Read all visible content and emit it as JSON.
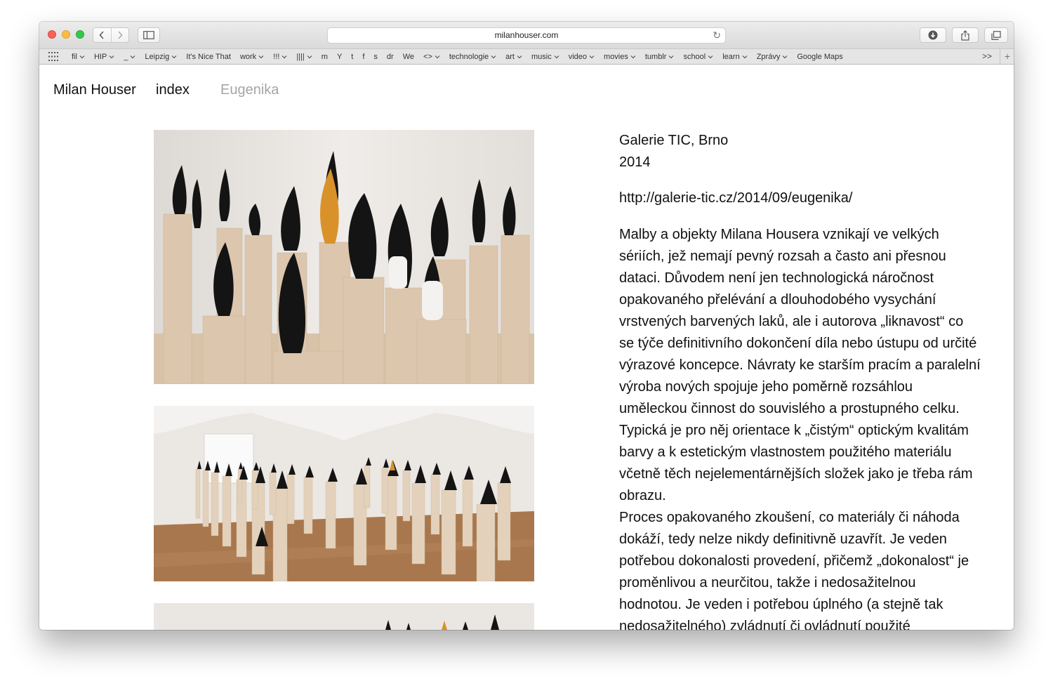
{
  "browser": {
    "url": "milanhouser.com",
    "bookmarks": [
      {
        "label": "fil",
        "menu": true
      },
      {
        "label": "HIP",
        "menu": true
      },
      {
        "label": "_",
        "menu": true
      },
      {
        "label": "Leipzig",
        "menu": true
      },
      {
        "label": "It's Nice That",
        "menu": false
      },
      {
        "label": "work",
        "menu": true
      },
      {
        "label": "!!!",
        "menu": true
      },
      {
        "label": "||||",
        "menu": true
      },
      {
        "label": "m",
        "menu": false
      },
      {
        "label": "Y",
        "menu": false
      },
      {
        "label": "t",
        "menu": false
      },
      {
        "label": "f",
        "menu": false
      },
      {
        "label": "s",
        "menu": false
      },
      {
        "label": "dr",
        "menu": false
      },
      {
        "label": "We",
        "menu": false
      },
      {
        "label": "<>",
        "menu": true
      },
      {
        "label": "technologie",
        "menu": true
      },
      {
        "label": "art",
        "menu": true
      },
      {
        "label": "music",
        "menu": true
      },
      {
        "label": "video",
        "menu": true
      },
      {
        "label": "movies",
        "menu": true
      },
      {
        "label": "tumblr",
        "menu": true
      },
      {
        "label": "school",
        "menu": true
      },
      {
        "label": "learn",
        "menu": true
      },
      {
        "label": "Zprávy",
        "menu": true
      },
      {
        "label": "Google Maps",
        "menu": false
      }
    ],
    "more_label": ">>",
    "plus_label": "+"
  },
  "site": {
    "name": "Milan Houser",
    "index": "index",
    "current": "Eugenika"
  },
  "exhibition": {
    "gallery": "Galerie TIC, Brno",
    "year": "2014",
    "link": "http://galerie-tic.cz/2014/09/eugenika/",
    "text": "Malby a objekty Milana Housera vznikají ve velkých\nsériích, jež nemají pevný rozsah a často ani přesnou\ndataci. Důvodem není jen technologická náročnost\nopakovaného přelévání a dlouhodobého vysychání\nvrstvených barvených laků, ale i autorova „liknavost“ co\nse týče definitivního dokončení díla nebo ústupu od určité\nvýrazové koncepce. Návraty ke starším pracím a paralelní\nvýroba nových spojuje jeho poměrně rozsáhlou\numěleckou činnost do souvislého a prostupného celku.\nTypická je pro něj orientace k „čistým“ optickým kvalitám\nbarvy a k estetickým vlastnostem použitého materiálu\nvčetně těch nejelementárnějších složek jako je třeba rám\nobrazu.\nProces opakovaného zkoušení, co materiály či náhoda\ndokáží, tedy nelze nikdy definitivně uzavřít. Je veden\npotřebou dokonalosti provedení, přičemž „dokonalost“ je\nproměnlivou a neurčitou, takže i nedosažitelnou\nhodnotou. Je veden i potřebou úplného (a stejně tak\nnedosažitelného) zvládnutí či ovládnutí použité"
  },
  "colors": {
    "nav_current": "#a5a5a5",
    "sculpture_black": "#141414",
    "pedestal": "#dcc6ad",
    "gallery_wall": "#ebe7e3"
  }
}
